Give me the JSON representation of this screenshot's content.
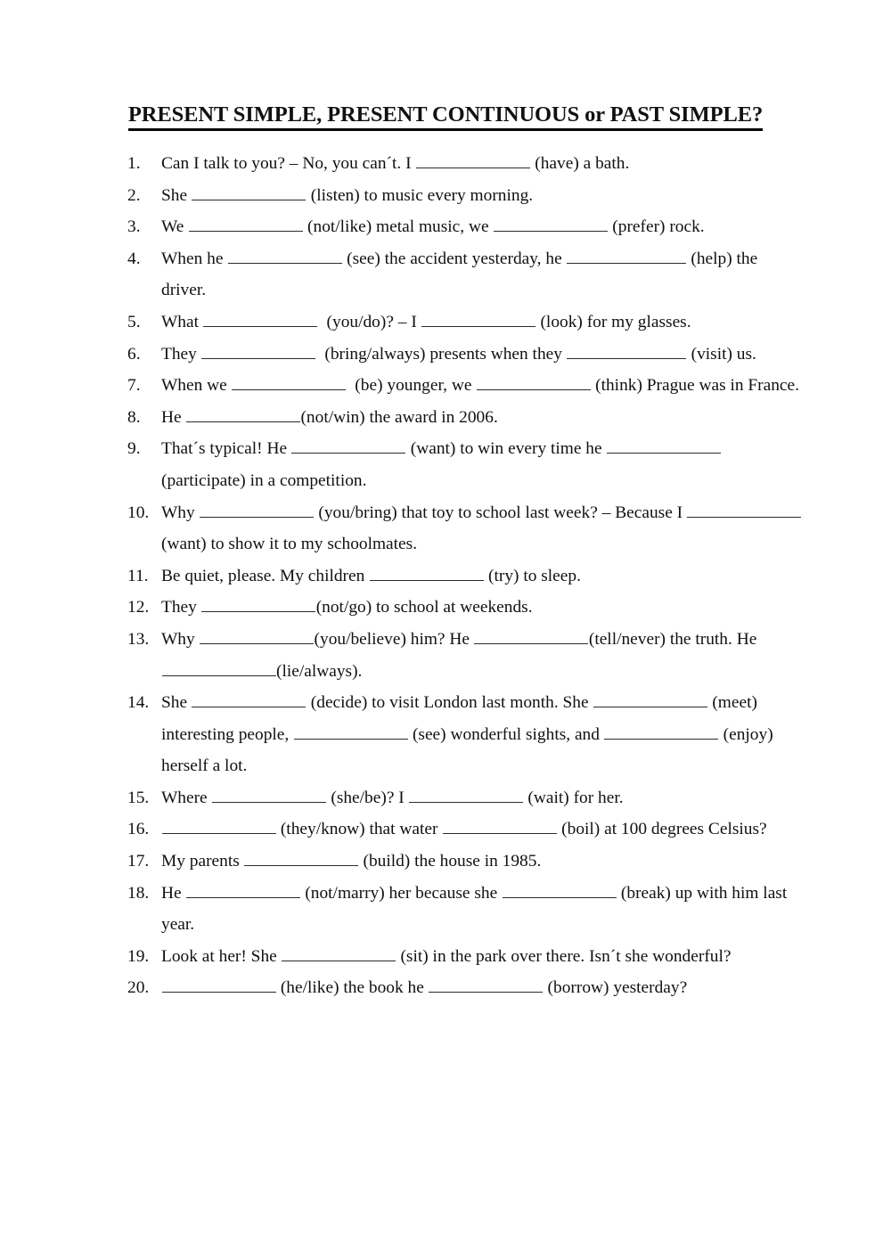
{
  "document": {
    "title": "PRESENT SIMPLE, PRESENT CONTINUOUS or PAST SIMPLE?",
    "type": "grammar-worksheet",
    "page_background": "#ffffff",
    "text_color": "#111111",
    "blank_line_color": "#2b2b2b"
  },
  "questions": [
    {
      "number": "1.",
      "text": "Can I talk to you? – No, you can´t. I ________________ (have) a bath.",
      "parts": [
        {
          "type": "text",
          "value": "Can I talk to you? – No, you can´t. I "
        },
        {
          "type": "blank",
          "width": "std"
        },
        {
          "type": "text",
          "value": " (have) a bath."
        }
      ]
    },
    {
      "number": "2.",
      "text": "She ________________ (listen) to music every morning.",
      "parts": [
        {
          "type": "text",
          "value": "She "
        },
        {
          "type": "blank",
          "width": "std"
        },
        {
          "type": "text",
          "value": " (listen) to music every morning."
        }
      ]
    },
    {
      "number": "3.",
      "text": "We ________________ (not/like) metal music, we ________________ (prefer) rock.",
      "parts": [
        {
          "type": "text",
          "value": "We "
        },
        {
          "type": "blank",
          "width": "std"
        },
        {
          "type": "text",
          "value": " (not/like) metal music, we "
        },
        {
          "type": "blank",
          "width": "std"
        },
        {
          "type": "text",
          "value": " (prefer) rock."
        }
      ]
    },
    {
      "number": "4.",
      "text": "When he ________________ (see) the accident yesterday, he ________________ (help) the driver.",
      "parts": [
        {
          "type": "text",
          "value": "When he "
        },
        {
          "type": "blank",
          "width": "std"
        },
        {
          "type": "text",
          "value": " (see) the accident yesterday, he "
        },
        {
          "type": "blank",
          "width": "wide"
        },
        {
          "type": "text",
          "value": " (help) the driver."
        }
      ]
    },
    {
      "number": "5.",
      "text": "What ________________  (you/do)? – I ________________ (look) for my glasses.",
      "parts": [
        {
          "type": "text",
          "value": "What "
        },
        {
          "type": "blank",
          "width": "std"
        },
        {
          "type": "text",
          "value": "  (you/do)? – I "
        },
        {
          "type": "blank",
          "width": "std"
        },
        {
          "type": "text",
          "value": " (look) for my glasses."
        }
      ]
    },
    {
      "number": "6.",
      "text": "They ________________ (bring/always) presents when they ________________ (visit) us.",
      "parts": [
        {
          "type": "text",
          "value": "They "
        },
        {
          "type": "blank",
          "width": "std"
        },
        {
          "type": "text",
          "value": "  (bring/always) presents when they "
        },
        {
          "type": "blank",
          "width": "wide"
        },
        {
          "type": "text",
          "value": " (visit) us."
        }
      ]
    },
    {
      "number": "7.",
      "text": "When we ________________ (be) younger, we ________________ (think) Prague was in France.",
      "parts": [
        {
          "type": "text",
          "value": "When we "
        },
        {
          "type": "blank",
          "width": "std"
        },
        {
          "type": "text",
          "value": "  (be) younger, we "
        },
        {
          "type": "blank",
          "width": "std"
        },
        {
          "type": "text",
          "value": " (think) Prague was in France."
        }
      ]
    },
    {
      "number": "8.",
      "text": "He ________________(not/win) the award in 2006.",
      "parts": [
        {
          "type": "text",
          "value": "He "
        },
        {
          "type": "blank",
          "width": "std"
        },
        {
          "type": "text",
          "value": "(not/win) the award in 2006."
        }
      ]
    },
    {
      "number": "9.",
      "text": "That´s typical! He ________________ (want) to win every time he ________________ (participate) in a competition.",
      "parts": [
        {
          "type": "text",
          "value": "That´s typical! He "
        },
        {
          "type": "blank",
          "width": "std"
        },
        {
          "type": "text",
          "value": " (want) to win every time he "
        },
        {
          "type": "blank",
          "width": "std"
        },
        {
          "type": "text",
          "value": " (participate) in a competition."
        }
      ]
    },
    {
      "number": "10.",
      "text": "Why ________________ (you/bring) that toy to school last week? – Because I ________________ (want) to show it to my schoolmates.",
      "parts": [
        {
          "type": "text",
          "value": "Why "
        },
        {
          "type": "blank",
          "width": "std"
        },
        {
          "type": "text",
          "value": " (you/bring) that toy to school last week? – Because I "
        },
        {
          "type": "blank",
          "width": "std"
        },
        {
          "type": "text",
          "value": " (want) to show it to my schoolmates."
        }
      ]
    },
    {
      "number": "11.",
      "text": "Be quiet, please. My children ________________ (try) to sleep.",
      "parts": [
        {
          "type": "text",
          "value": "Be quiet, please. My children "
        },
        {
          "type": "blank",
          "width": "std"
        },
        {
          "type": "text",
          "value": " (try) to sleep."
        }
      ]
    },
    {
      "number": "12.",
      "text": "They ________________(not/go) to school at weekends.",
      "parts": [
        {
          "type": "text",
          "value": "They "
        },
        {
          "type": "blank",
          "width": "std"
        },
        {
          "type": "text",
          "value": "(not/go) to school at weekends."
        }
      ]
    },
    {
      "number": "13.",
      "text": "Why ________________(you/believe) him? He ________________(tell/never) the truth. He ________________(lie/always).",
      "parts": [
        {
          "type": "text",
          "value": "Why "
        },
        {
          "type": "blank",
          "width": "std"
        },
        {
          "type": "text",
          "value": "(you/believe) him? He "
        },
        {
          "type": "blank",
          "width": "std"
        },
        {
          "type": "text",
          "value": "(tell/never) the truth. He "
        },
        {
          "type": "blank",
          "width": "std"
        },
        {
          "type": "text",
          "value": "(lie/always)."
        }
      ]
    },
    {
      "number": "14.",
      "text": "She ________________ (decide) to visit London last month. She ________________ (meet) interesting people, ________________ (see) wonderful sights, and ________________ (enjoy) herself a lot.",
      "parts": [
        {
          "type": "text",
          "value": "She "
        },
        {
          "type": "blank",
          "width": "std"
        },
        {
          "type": "text",
          "value": " (decide) to visit London last month. She "
        },
        {
          "type": "blank",
          "width": "std"
        },
        {
          "type": "text",
          "value": " (meet) interesting people, "
        },
        {
          "type": "blank",
          "width": "std"
        },
        {
          "type": "text",
          "value": " (see) wonderful sights, and "
        },
        {
          "type": "blank",
          "width": "std"
        },
        {
          "type": "text",
          "value": " (enjoy) herself a lot."
        }
      ]
    },
    {
      "number": "15.",
      "text": "Where ________________ (she/be)? I ________________ (wait) for her.",
      "parts": [
        {
          "type": "text",
          "value": "Where "
        },
        {
          "type": "blank",
          "width": "std"
        },
        {
          "type": "text",
          "value": " (she/be)? I "
        },
        {
          "type": "blank",
          "width": "std"
        },
        {
          "type": "text",
          "value": " (wait) for her."
        }
      ]
    },
    {
      "number": "16.",
      "text": "________________ (they/know) that water ________________ (boil) at 100 degrees Celsius?",
      "parts": [
        {
          "type": "blank",
          "width": "std"
        },
        {
          "type": "text",
          "value": " (they/know) that water "
        },
        {
          "type": "blank",
          "width": "std"
        },
        {
          "type": "text",
          "value": " (boil) at 100 degrees Celsius?"
        }
      ]
    },
    {
      "number": "17.",
      "text": "My parents ________________ (build) the house in 1985.",
      "parts": [
        {
          "type": "text",
          "value": "My parents "
        },
        {
          "type": "blank",
          "width": "std"
        },
        {
          "type": "text",
          "value": " (build) the house in 1985."
        }
      ]
    },
    {
      "number": "18.",
      "text": "He ________________ (not/marry) her because she ________________ (break) up with him last year.",
      "parts": [
        {
          "type": "text",
          "value": "He "
        },
        {
          "type": "blank",
          "width": "std"
        },
        {
          "type": "text",
          "value": " (not/marry) her because she "
        },
        {
          "type": "blank",
          "width": "std"
        },
        {
          "type": "text",
          "value": " (break) up with him last year."
        }
      ]
    },
    {
      "number": "19.",
      "text": "Look at her! She ________________ (sit) in the park over there. Isn´t she wonderful?",
      "parts": [
        {
          "type": "text",
          "value": "Look at her! She "
        },
        {
          "type": "blank",
          "width": "std"
        },
        {
          "type": "text",
          "value": " (sit) in the park over there. Isn´t she wonderful?"
        }
      ]
    },
    {
      "number": "20.",
      "text": "________________ (he/like) the book he ________________ (borrow) yesterday?",
      "parts": [
        {
          "type": "blank",
          "width": "std"
        },
        {
          "type": "text",
          "value": " (he/like) the book he "
        },
        {
          "type": "blank",
          "width": "std"
        },
        {
          "type": "text",
          "value": " (borrow) yesterday?"
        }
      ]
    }
  ]
}
